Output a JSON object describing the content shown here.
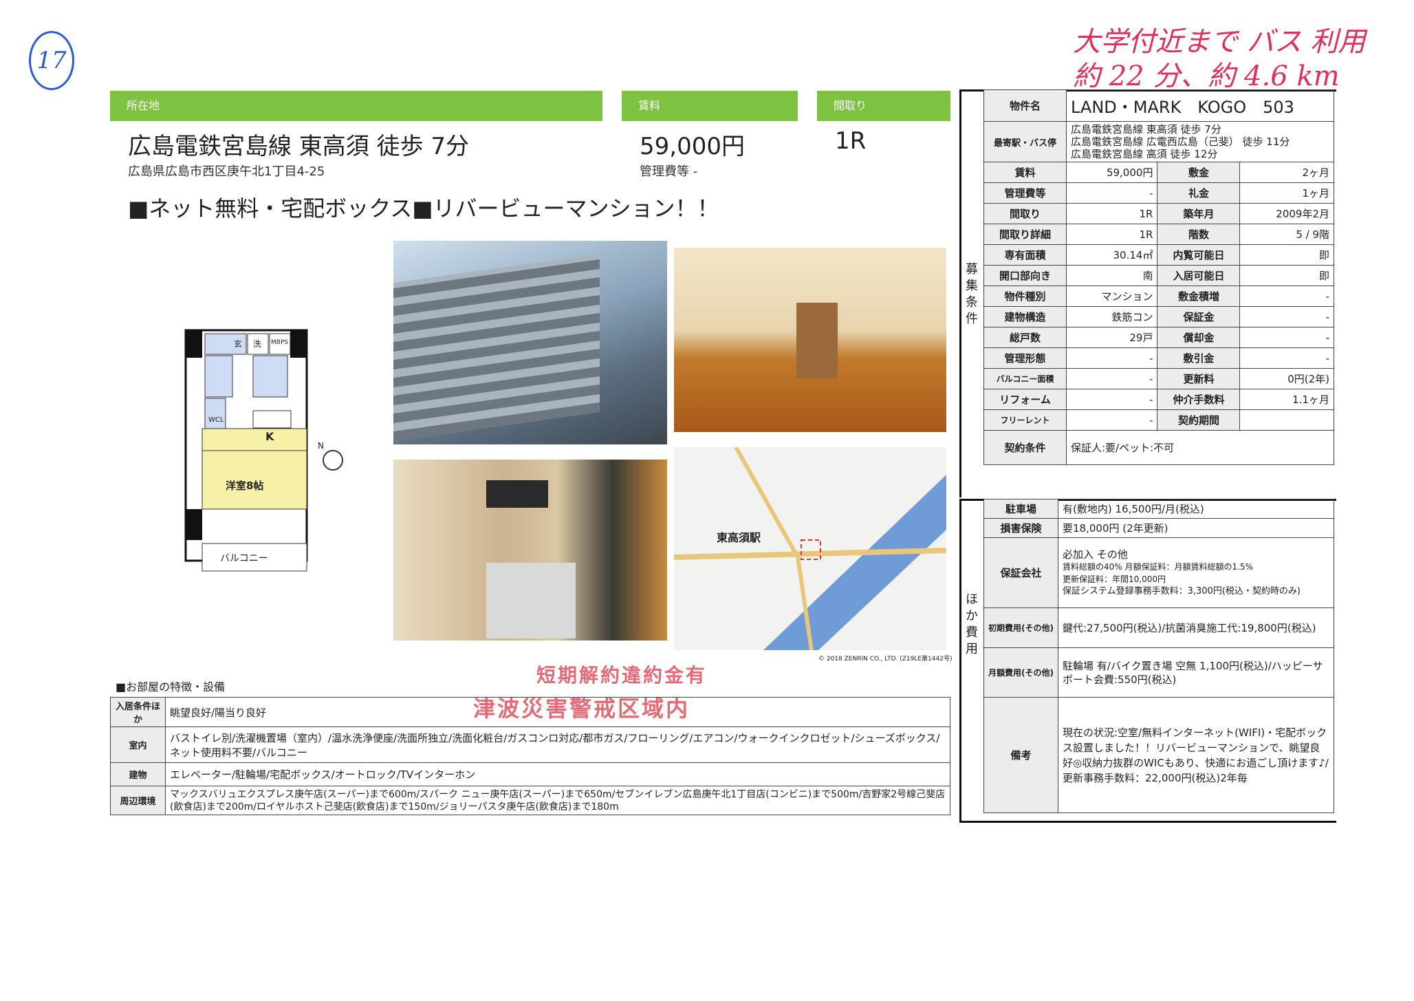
{
  "handwriting": {
    "page_mark": "17",
    "note_line1": "大学付近まで バス 利用",
    "note_line2": "約 22 分、約 4.6 km"
  },
  "header": {
    "location_label": "所在地",
    "rent_label": "賃料",
    "layout_label": "間取り",
    "station": "広島電鉄宮島線 東高須 徒歩 7分",
    "address": "広島県広島市西区庚午北1丁目4-25",
    "rent": "59,000円",
    "mgmt_fee": "管理費等 -",
    "layout": "1R"
  },
  "catchcopy": "■ネット無料・宅配ボックス■リバービューマンション！！",
  "floorplan": {
    "entrance": "玄",
    "laundry": "洗",
    "mbps": "MBPS",
    "wcl": "WCL",
    "kitchen": "K",
    "room": "洋室8帖",
    "balcony": "バルコニー",
    "compass": "N"
  },
  "map": {
    "station_label": "東高須駅",
    "copyright": "© 2018 ZENRIN CO., LTD. (Z19LE第1442号)"
  },
  "stamps": {
    "stamp1": "短期解約違約金有",
    "stamp2": "津波災害警戒区域内"
  },
  "spec": {
    "name_label": "物件名",
    "name": "LAND・MARK　KOGO　503",
    "station_label": "最寄駅・バス停",
    "stations": [
      "広島電鉄宮島線 東高須 徒歩 7分",
      "広島電鉄宮島線 広電西広島（己斐） 徒歩 11分",
      "広島電鉄宮島線 高須 徒歩 12分"
    ],
    "side_label": "募集条件",
    "rows": [
      [
        "賃料",
        "59,000円",
        "敷金",
        "2ヶ月"
      ],
      [
        "管理費等",
        "-",
        "礼金",
        "1ヶ月"
      ],
      [
        "間取り",
        "1R",
        "築年月",
        "2009年2月"
      ],
      [
        "間取り詳細",
        "1R",
        "階数",
        "5 / 9階"
      ],
      [
        "専有面積",
        "30.14㎡",
        "内覧可能日",
        "即"
      ],
      [
        "開口部向き",
        "南",
        "入居可能日",
        "即"
      ],
      [
        "物件種別",
        "マンション",
        "敷金積増",
        "-"
      ],
      [
        "建物構造",
        "鉄筋コン",
        "保証金",
        "-"
      ],
      [
        "総戸数",
        "29戸",
        "償却金",
        "-"
      ],
      [
        "管理形態",
        "-",
        "敷引金",
        "-"
      ],
      [
        "バルコニー面積",
        "-",
        "更新料",
        "0円(2年)"
      ],
      [
        "リフォーム",
        "-",
        "仲介手数料",
        "1.1ヶ月"
      ],
      [
        "フリーレント",
        "-",
        "契約期間",
        ""
      ]
    ],
    "contract_label": "契約条件",
    "contract": "保証人:要/ペット:不可"
  },
  "other": {
    "side_label": "ほか費用",
    "parking_label": "駐車場",
    "parking": "有(敷地内) 16,500円/月(税込)",
    "insurance_label": "損害保険",
    "insurance": "要18,000円 (2年更新)",
    "guarantee_label": "保証会社",
    "guarantee_lines": [
      "必加入 その他",
      "賃料総額の40% 月額保証料：月額賃料総額の1.5%",
      "更新保証料：年間10,000円",
      "保証システム登録事務手数料：3,300円(税込・契約時のみ)"
    ],
    "initial_label": "初期費用(その他)",
    "initial": "鍵代:27,500円(税込)/抗菌消臭施工代:19,800円(税込)",
    "monthly_label": "月額費用(その他)",
    "monthly": "駐輪場 有/バイク置き場 空無 1,100円(税込)/ハッピーサポート会費:550円(税込)",
    "remarks_label": "備考",
    "remarks": "現在の状況:空室/無料インターネット(WIFI)・宅配ボックス設置しました！！リバービューマンションで、眺望良好◎収納力抜群のWICもあり、快適にお過ごし頂けます♪/更新事務手数料：22,000円(税込)2年毎"
  },
  "features": {
    "title": "■お部屋の特徴・設備",
    "rows": [
      {
        "label": "入居条件ほか",
        "value": "眺望良好/陽当り良好"
      },
      {
        "label": "室内",
        "value": "バストイレ別/洗濯機置場（室内）/温水洗浄便座/洗面所独立/洗面化粧台/ガスコンロ対応/都市ガス/フローリング/エアコン/ウォークインクロゼット/シューズボックス/ネット使用料不要/バルコニー"
      },
      {
        "label": "建物",
        "value": "エレベーター/駐輪場/宅配ボックス/オートロック/TVインターホン"
      },
      {
        "label": "周辺環境",
        "value": "マックスバリュエクスプレス庚午店(スーパー)まで600m/スパーク ニュー庚午店(スーパー)まで650m/セブンイレブン広島庚午北1丁目店(コンビニ)まで500m/吉野家2号線己斐店(飲食店)まで200m/ロイヤルホスト己斐店(飲食店)まで150m/ジョリーパスタ庚午店(飲食店)まで180m"
      }
    ]
  }
}
